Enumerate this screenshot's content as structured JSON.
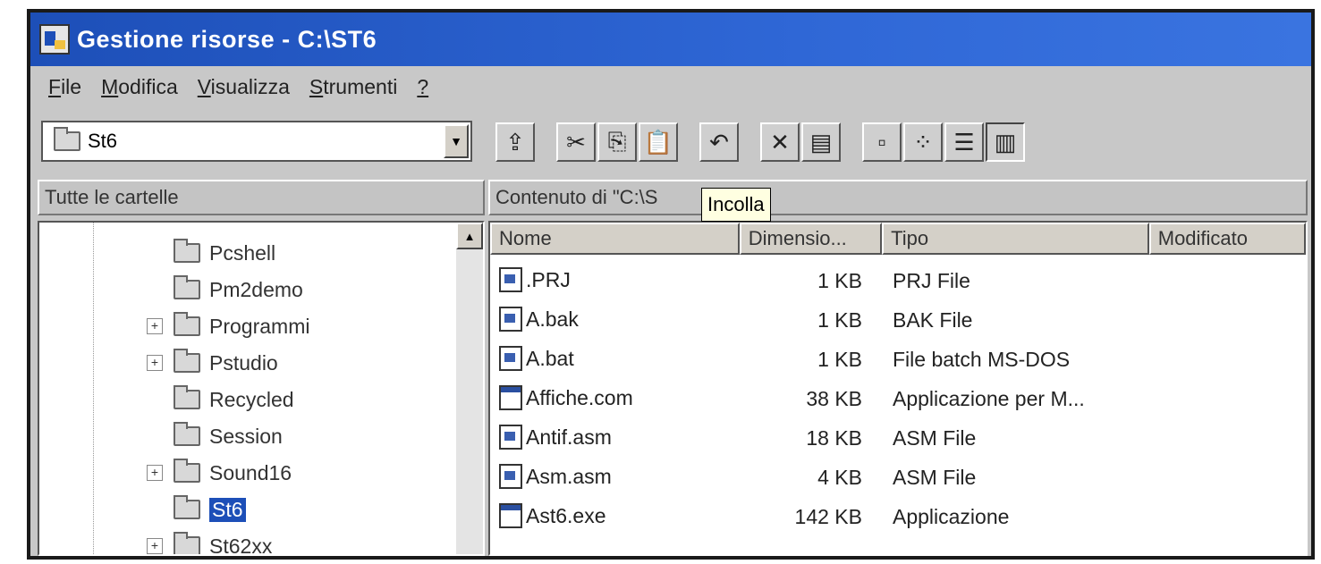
{
  "window": {
    "title": "Gestione risorse - C:\\ST6"
  },
  "menu": [
    {
      "ul": "F",
      "rest": "ile"
    },
    {
      "ul": "M",
      "rest": "odifica"
    },
    {
      "ul": "V",
      "rest": "isualizza"
    },
    {
      "ul": "S",
      "rest": "trumenti"
    },
    {
      "ul": "?",
      "rest": ""
    }
  ],
  "address": {
    "value": "St6"
  },
  "left_pane": {
    "header": "Tutte le cartelle"
  },
  "right_pane": {
    "header": "Contenuto di \"C:\\S"
  },
  "tooltip": "Incolla",
  "tree": [
    {
      "label": "Pcshell",
      "expandable": false,
      "selected": false
    },
    {
      "label": "Pm2demo",
      "expandable": false,
      "selected": false
    },
    {
      "label": "Programmi",
      "expandable": true,
      "selected": false
    },
    {
      "label": "Pstudio",
      "expandable": true,
      "selected": false
    },
    {
      "label": "Recycled",
      "expandable": false,
      "selected": false
    },
    {
      "label": "Session",
      "expandable": false,
      "selected": false
    },
    {
      "label": "Sound16",
      "expandable": true,
      "selected": false
    },
    {
      "label": "St6",
      "expandable": false,
      "selected": true
    },
    {
      "label": "St62xx",
      "expandable": true,
      "selected": false
    }
  ],
  "columns": [
    "Nome",
    "Dimensio...",
    "Tipo",
    "Modificato"
  ],
  "files": [
    {
      "name": ".PRJ",
      "size": "1 KB",
      "type": "PRJ File",
      "icon": "doc"
    },
    {
      "name": "A.bak",
      "size": "1 KB",
      "type": "BAK File",
      "icon": "doc"
    },
    {
      "name": "A.bat",
      "size": "1 KB",
      "type": "File batch MS-DOS",
      "icon": "doc"
    },
    {
      "name": "Affiche.com",
      "size": "38 KB",
      "type": "Applicazione per M...",
      "icon": "app"
    },
    {
      "name": "Antif.asm",
      "size": "18 KB",
      "type": "ASM File",
      "icon": "doc"
    },
    {
      "name": "Asm.asm",
      "size": "4 KB",
      "type": "ASM File",
      "icon": "doc"
    },
    {
      "name": "Ast6.exe",
      "size": "142 KB",
      "type": "Applicazione",
      "icon": "app"
    }
  ],
  "toolbar": [
    {
      "name": "up-folder-button",
      "icon": "up-folder-icon",
      "glyph": "⇪"
    },
    {
      "sep": true
    },
    {
      "name": "cut-button",
      "icon": "scissors-icon",
      "glyph": "✂"
    },
    {
      "name": "copy-button",
      "icon": "copy-icon",
      "glyph": "⎘"
    },
    {
      "name": "paste-button",
      "icon": "paste-icon",
      "glyph": "📋"
    },
    {
      "sep": true
    },
    {
      "name": "undo-button",
      "icon": "undo-icon",
      "glyph": "↶"
    },
    {
      "sep": true
    },
    {
      "name": "delete-button",
      "icon": "delete-icon",
      "glyph": "✕"
    },
    {
      "name": "properties-button",
      "icon": "properties-icon",
      "glyph": "▤"
    },
    {
      "sep": true
    },
    {
      "name": "large-icons-button",
      "icon": "large-icons-icon",
      "glyph": "▫"
    },
    {
      "name": "small-icons-button",
      "icon": "small-icons-icon",
      "glyph": "⁘"
    },
    {
      "name": "list-view-button",
      "icon": "list-view-icon",
      "glyph": "☰"
    },
    {
      "name": "details-view-button",
      "icon": "details-view-icon",
      "glyph": "▥",
      "pressed": true
    }
  ]
}
